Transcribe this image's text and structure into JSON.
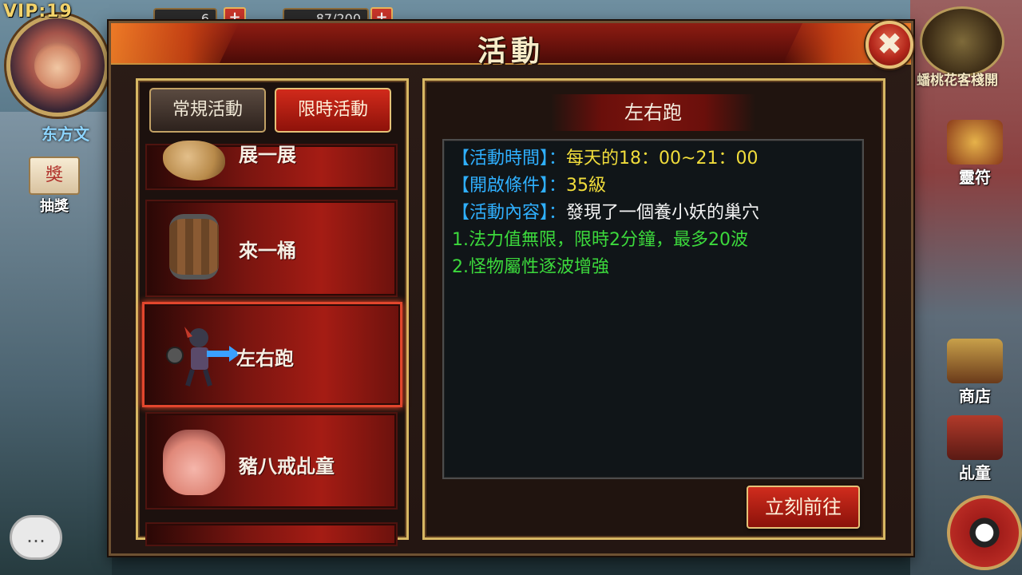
{
  "hud": {
    "vip": "VIP:19",
    "player_name": "东方文",
    "resource1_value": "6",
    "resource2_value": "87/200",
    "lottery_label": "抽獎",
    "right_banner": "蟠桃花客棧開",
    "right_icons": [
      "靈符",
      "商店",
      "乩童"
    ],
    "chat_icon": "chat-bubble-icon"
  },
  "dialog": {
    "title": "活動",
    "close_icon": "close-icon"
  },
  "tabs": [
    {
      "label": "常規活動",
      "active": false
    },
    {
      "label": "限時活動",
      "active": true
    }
  ],
  "list": {
    "items": [
      {
        "label": "展一展",
        "icon": "rock-pile-icon"
      },
      {
        "label": "來一桶",
        "icon": "barrel-icon"
      },
      {
        "label": "左右跑",
        "icon": "runner-icon",
        "selected": true
      },
      {
        "label": "豬八戒乩童",
        "icon": "pig-face-icon"
      }
    ]
  },
  "detail": {
    "title": "左右跑",
    "lines": [
      {
        "key": "【活動時間】",
        "sep": "：",
        "value": "每天的18：00~21：00"
      },
      {
        "key": "【開啟條件】",
        "sep": "：",
        "value": "35級"
      },
      {
        "key": "【活動內容】",
        "sep": "：",
        "value": "發現了一個養小妖的巢穴"
      }
    ],
    "notes": [
      "1.法力值無限，限時2分鐘，最多20波",
      "2.怪物屬性逐波增強"
    ],
    "go_button": "立刻前往"
  },
  "colors": {
    "accent_red": "#a51c14",
    "gold_border": "#d7b763",
    "key_blue": "#2fb0ff",
    "value_yellow": "#f1dd3b",
    "note_green": "#3cd93c"
  }
}
